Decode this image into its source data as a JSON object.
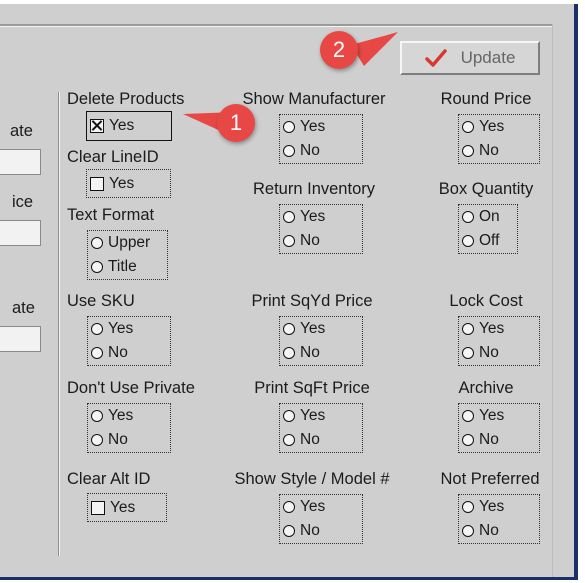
{
  "toolbar": {
    "update_label": "Update"
  },
  "callouts": {
    "one": "1",
    "two": "2"
  },
  "left_fields": [
    {
      "label": "ate"
    },
    {
      "label": "ice"
    },
    {
      "label": "ate"
    }
  ],
  "col1": {
    "delete_products": {
      "label": "Delete Products",
      "option": "Yes"
    },
    "clear_lineid": {
      "label": "Clear LineID",
      "option": "Yes"
    },
    "text_format": {
      "label": "Text Format",
      "options": [
        "Upper",
        "Title"
      ]
    },
    "use_sku": {
      "label": "Use SKU",
      "options": [
        "Yes",
        "No"
      ]
    },
    "dont_use_private": {
      "label": "Don't Use Private",
      "options": [
        "Yes",
        "No"
      ]
    },
    "clear_alt_id": {
      "label": "Clear Alt ID",
      "option": "Yes"
    }
  },
  "col2": {
    "show_manufacturer": {
      "label": "Show Manufacturer",
      "options": [
        "Yes",
        "No"
      ]
    },
    "return_inventory": {
      "label": "Return Inventory",
      "options": [
        "Yes",
        "No"
      ]
    },
    "print_sqyd_price": {
      "label": "Print SqYd Price",
      "options": [
        "Yes",
        "No"
      ]
    },
    "print_sqft_price": {
      "label": "Print SqFt Price",
      "options": [
        "Yes",
        "No"
      ]
    },
    "show_style_model": {
      "label": "Show Style / Model #",
      "options": [
        "Yes",
        "No"
      ]
    }
  },
  "col3": {
    "round_price": {
      "label": "Round Price",
      "options": [
        "Yes",
        "No"
      ]
    },
    "box_quantity": {
      "label": "Box Quantity",
      "options": [
        "On",
        "Off"
      ]
    },
    "lock_cost": {
      "label": "Lock Cost",
      "options": [
        "Yes",
        "No"
      ]
    },
    "archive": {
      "label": "Archive",
      "options": [
        "Yes",
        "No"
      ]
    },
    "not_preferred": {
      "label": "Not Preferred",
      "options": [
        "Yes",
        "No"
      ]
    }
  },
  "icons": {
    "checkmark": "checkmark-icon",
    "callout_color": "#e84845"
  }
}
